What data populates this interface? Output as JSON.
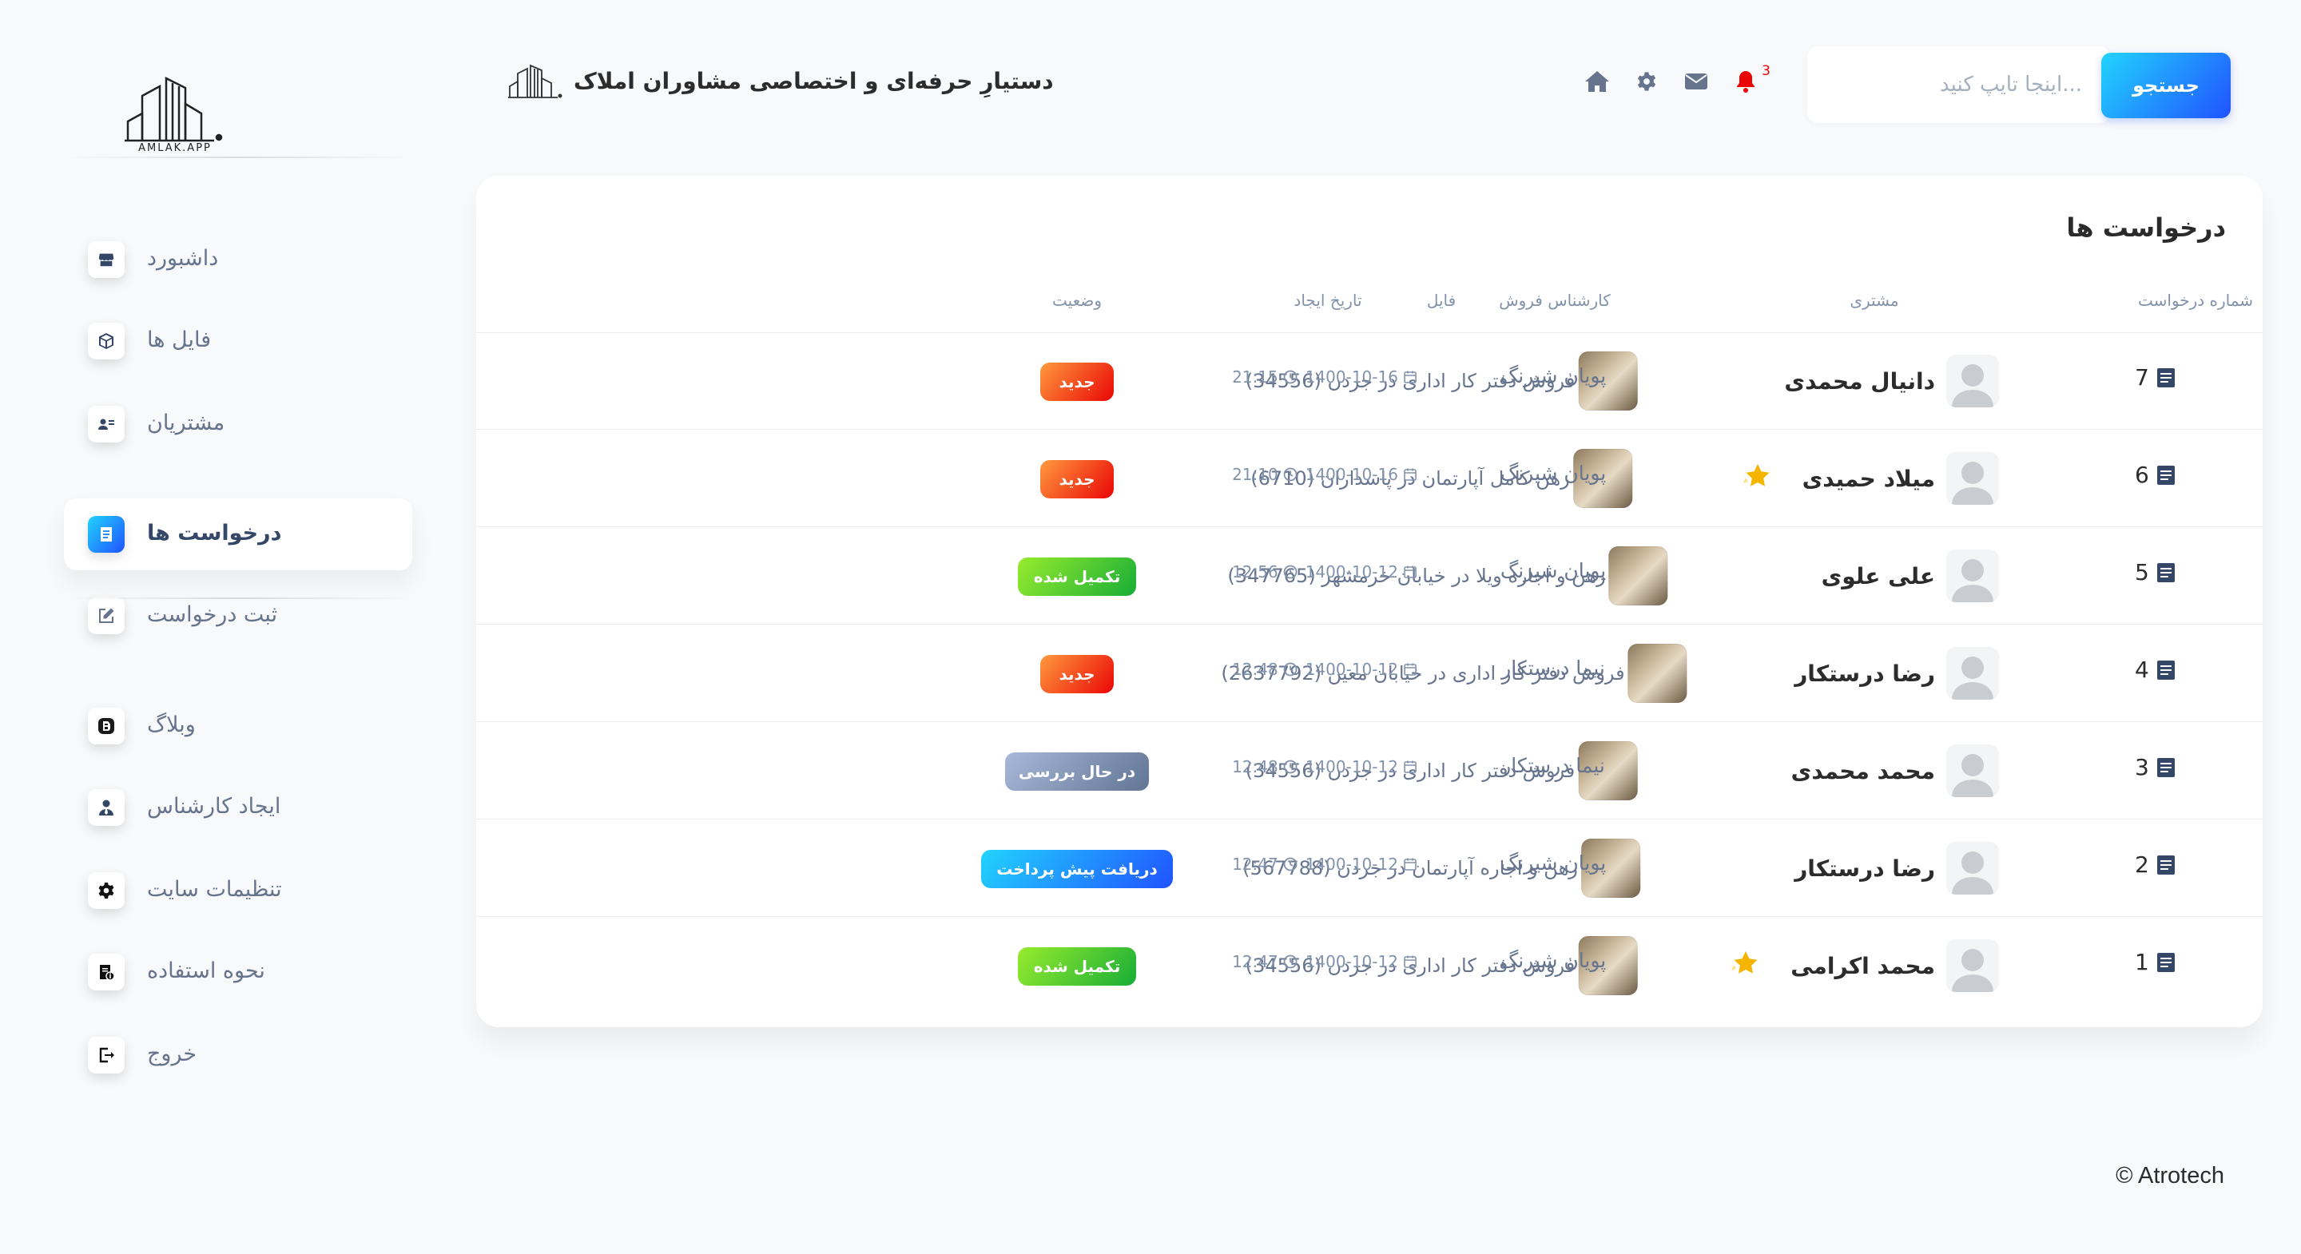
{
  "brand": {
    "logo_text": "AMLAK.APP",
    "title": "دستیارِ حرفه‌ای و اختصاصی مشاوران املاک"
  },
  "header": {
    "notification_count": "3",
    "search": {
      "placeholder": "...اینجا تایپ کنید",
      "button_label": "جستجو"
    }
  },
  "sidebar": {
    "items": [
      {
        "label": "داشبورد",
        "icon": "shop-icon",
        "active": false
      },
      {
        "label": "فایل ها",
        "icon": "box-icon",
        "active": false
      },
      {
        "label": "مشتریان",
        "icon": "customer-card-icon",
        "active": false
      },
      {
        "label": "درخواست ها",
        "icon": "document-icon",
        "active": true
      },
      {
        "label": "ثبت درخواست",
        "icon": "edit-icon",
        "active": false
      },
      {
        "label": "وبلاگ",
        "icon": "blog-icon",
        "active": false
      },
      {
        "label": "ایجاد کارشناس",
        "icon": "user-tie-icon",
        "active": false
      },
      {
        "label": "تنظیمات سایت",
        "icon": "gear-icon",
        "active": false
      },
      {
        "label": "نحوه استفاده",
        "icon": "manual-icon",
        "active": false
      },
      {
        "label": "خروج",
        "icon": "logout-icon",
        "active": false
      }
    ]
  },
  "requests": {
    "title": "درخواست ها",
    "columns": [
      "شماره درخواست",
      "مشتری",
      "فایل",
      "کارشناس فروش",
      "تاریخ ایجاد",
      "وضعیت"
    ],
    "rows": [
      {
        "number": "7",
        "customer": "دانیال محمدی",
        "starred": false,
        "file": "فروش دفتر کار اداری در جردن (34556)",
        "agent": "پویان شیرنگ",
        "date": "1400-10-16",
        "time": "21:15",
        "status": "جدید",
        "status_type": "new"
      },
      {
        "number": "6",
        "customer": "میلاد حمیدی",
        "starred": true,
        "file": "رهن کامل آپارتمان در پاسداران (6710)",
        "agent": "پویان شیرنگ",
        "date": "1400-10-16",
        "time": "21:10",
        "status": "جدید",
        "status_type": "new"
      },
      {
        "number": "5",
        "customer": "علی علوی",
        "starred": false,
        "file": "رهن و اجاره ویلا در خیابان خرمشهر (347765)",
        "agent": "پویان شیرنگ",
        "date": "1400-10-12",
        "time": "12:56",
        "status": "تکمیل شده",
        "status_type": "done"
      },
      {
        "number": "4",
        "customer": "رضا درستکار",
        "starred": false,
        "file": "فروش دفتر کار اداری در خیابان معین (2637792)",
        "agent": "نیما درستکار",
        "date": "1400-10-12",
        "time": "12:48",
        "status": "جدید",
        "status_type": "new"
      },
      {
        "number": "3",
        "customer": "محمد محمدی",
        "starred": false,
        "file": "فروش دفتر کار اداری در جردن (34556)",
        "agent": "نیما درستکار",
        "date": "1400-10-12",
        "time": "12:48",
        "status": "در حال بررسی",
        "status_type": "review"
      },
      {
        "number": "2",
        "customer": "رضا درستکار",
        "starred": false,
        "file": "رهن و اجاره آپارتمان در جردن (567788)",
        "agent": "پویان شیرنگ",
        "date": "1400-10-12",
        "time": "12:47",
        "status": "دریافت پیش پرداخت",
        "status_type": "prepay"
      },
      {
        "number": "1",
        "customer": "محمد اکرامی",
        "starred": true,
        "file": "فروش دفتر کار اداری در جردن (34556)",
        "agent": "پویان شیرنگ",
        "date": "1400-10-12",
        "time": "12:47",
        "status": "تکمیل شده",
        "status_type": "done"
      }
    ]
  },
  "footer": {
    "copyright": "© Atrotech"
  },
  "colors": {
    "accent_start": "#2152ff",
    "accent_end": "#21d4fd",
    "new": "#ea0606",
    "done": "#17ad37",
    "review": "#627594"
  }
}
